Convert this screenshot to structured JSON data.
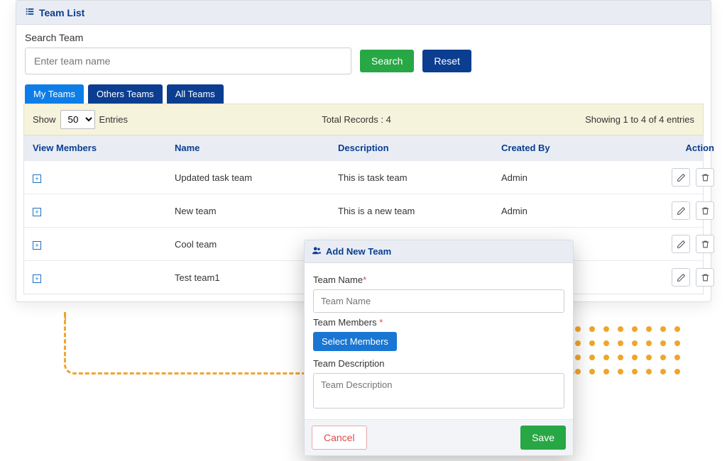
{
  "panel": {
    "title": "Team List"
  },
  "search": {
    "label": "Search Team",
    "placeholder": "Enter team name",
    "search_btn": "Search",
    "reset_btn": "Reset"
  },
  "tabs": [
    {
      "label": "My Teams",
      "active": true
    },
    {
      "label": "Others Teams",
      "active": false
    },
    {
      "label": "All Teams",
      "active": false
    }
  ],
  "meta": {
    "show_text": "Show",
    "entries_text": "Entries",
    "page_size": "50",
    "total_text": "Total Records : 4",
    "range_text": "Showing 1 to 4 of 4 entries"
  },
  "columns": {
    "view": "View Members",
    "name": "Name",
    "desc": "Description",
    "created": "Created By",
    "action": "Action"
  },
  "rows": [
    {
      "name": "Updated task team",
      "desc": "This is task team",
      "created": "Admin"
    },
    {
      "name": "New team",
      "desc": "This is a new team",
      "created": "Admin"
    },
    {
      "name": "Cool team",
      "desc": "",
      "created": ""
    },
    {
      "name": "Test team1",
      "desc": "",
      "created": ""
    }
  ],
  "modal": {
    "title": "Add New Team",
    "name_label": "Team Name",
    "name_placeholder": "Team Name",
    "members_label": "Team Members ",
    "select_members_btn": "Select Members",
    "desc_label": "Team Description",
    "desc_placeholder": "Team Description",
    "cancel_btn": "Cancel",
    "save_btn": "Save"
  }
}
